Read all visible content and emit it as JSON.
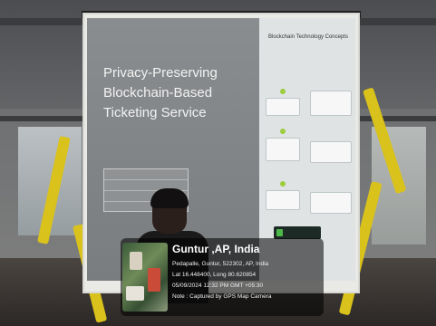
{
  "slide": {
    "header": "",
    "title_line1": "Privacy-Preserving",
    "title_line2": "Blockchain-Based",
    "title_line3": "Ticketing Service",
    "diagram_title": "Blockchain Technology Concepts"
  },
  "gps_stamp": {
    "city": "Guntur ,AP, India",
    "address": "Pedapalle, Guntur, 522302, AP, India",
    "coords": "Lat 16.448400, Long 80.620854",
    "datetime": "05/09/2024 12:32 PM GMT +05:30",
    "credit": "Note : Captured by GPS Map Camera"
  },
  "colors": {
    "slide_bg": "#7f8284",
    "truss": "#d9c21b",
    "stamp_bg": "#000000"
  }
}
